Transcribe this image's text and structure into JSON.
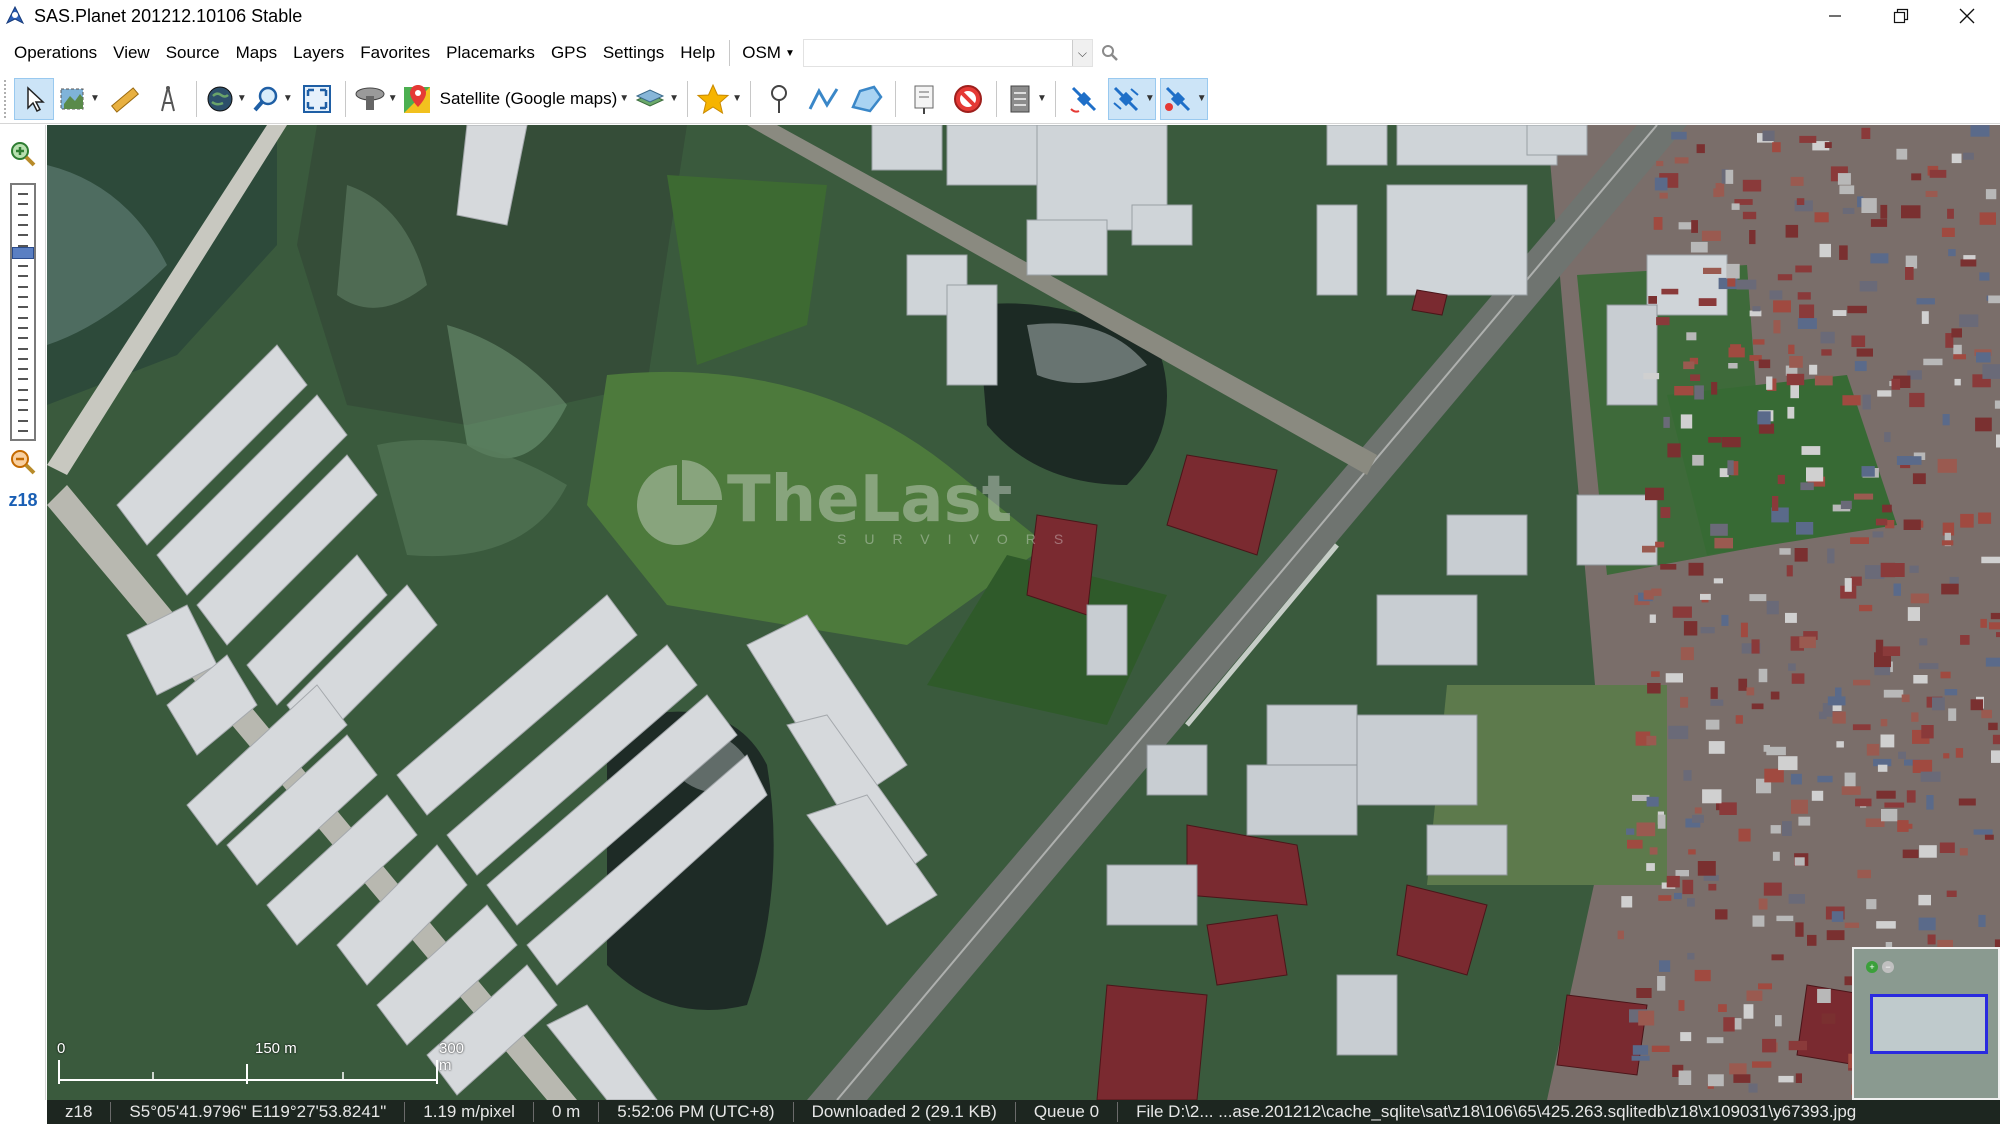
{
  "window": {
    "title": "SAS.Planet 201212.10106 Stable",
    "controls": [
      "minimize",
      "restore",
      "close"
    ]
  },
  "menu": {
    "items": [
      {
        "label": "Operations"
      },
      {
        "label": "View"
      },
      {
        "label": "Source"
      },
      {
        "label": "Maps"
      },
      {
        "label": "Layers"
      },
      {
        "label": "Favorites"
      },
      {
        "label": "Placemarks"
      },
      {
        "label": "GPS"
      },
      {
        "label": "Settings"
      },
      {
        "label": "Help"
      }
    ],
    "search_source": "OSM",
    "search_value": ""
  },
  "toolbar": {
    "map_source_label": "Satellite (Google maps)",
    "buttons": [
      {
        "name": "pointer-icon",
        "active": true
      },
      {
        "name": "select-region-icon"
      },
      {
        "name": "ruler-icon"
      },
      {
        "name": "compass-icon"
      },
      {
        "name": "globe-icon"
      },
      {
        "name": "zoom-tool-icon"
      },
      {
        "name": "fullscreen-icon"
      },
      {
        "name": "gps-device-icon"
      },
      {
        "name": "google-maps-icon"
      },
      {
        "name": "layers-icon"
      },
      {
        "name": "favorites-star-icon"
      },
      {
        "name": "placemark-pin-icon"
      },
      {
        "name": "path-icon"
      },
      {
        "name": "polygon-icon"
      },
      {
        "name": "placemark-list-icon"
      },
      {
        "name": "no-entry-icon"
      },
      {
        "name": "server-icon"
      },
      {
        "name": "satellite-gps-icon"
      },
      {
        "name": "satellite-track-icon",
        "active": true
      },
      {
        "name": "satellite-center-icon",
        "active": true
      }
    ]
  },
  "zoom": {
    "level_label": "z18"
  },
  "map": {
    "watermark_text": "TheLast",
    "watermark_sub": "SURVIVORS",
    "scale": {
      "labels": [
        "0",
        "150 m",
        "300 m"
      ]
    }
  },
  "status": {
    "zoom": "z18",
    "coordinates": "S5°05'41.9796\" E119°27'53.8241\"",
    "resolution": "1.19 m/pixel",
    "distance": "0 m",
    "time": "5:52:06 PM (UTC+8)",
    "downloaded": "Downloaded 2 (29.1 KB)",
    "queue": "Queue 0",
    "file": "File D:\\2... ...ase.201212\\cache_sqlite\\sat\\z18\\106\\65\\425.263.sqlitedb\\z18\\x109031\\y67393.jpg"
  },
  "colors": {
    "accent": "#1a5fb4",
    "active_button": "#cce4f7",
    "statusbar_bg": "#1d2620"
  }
}
